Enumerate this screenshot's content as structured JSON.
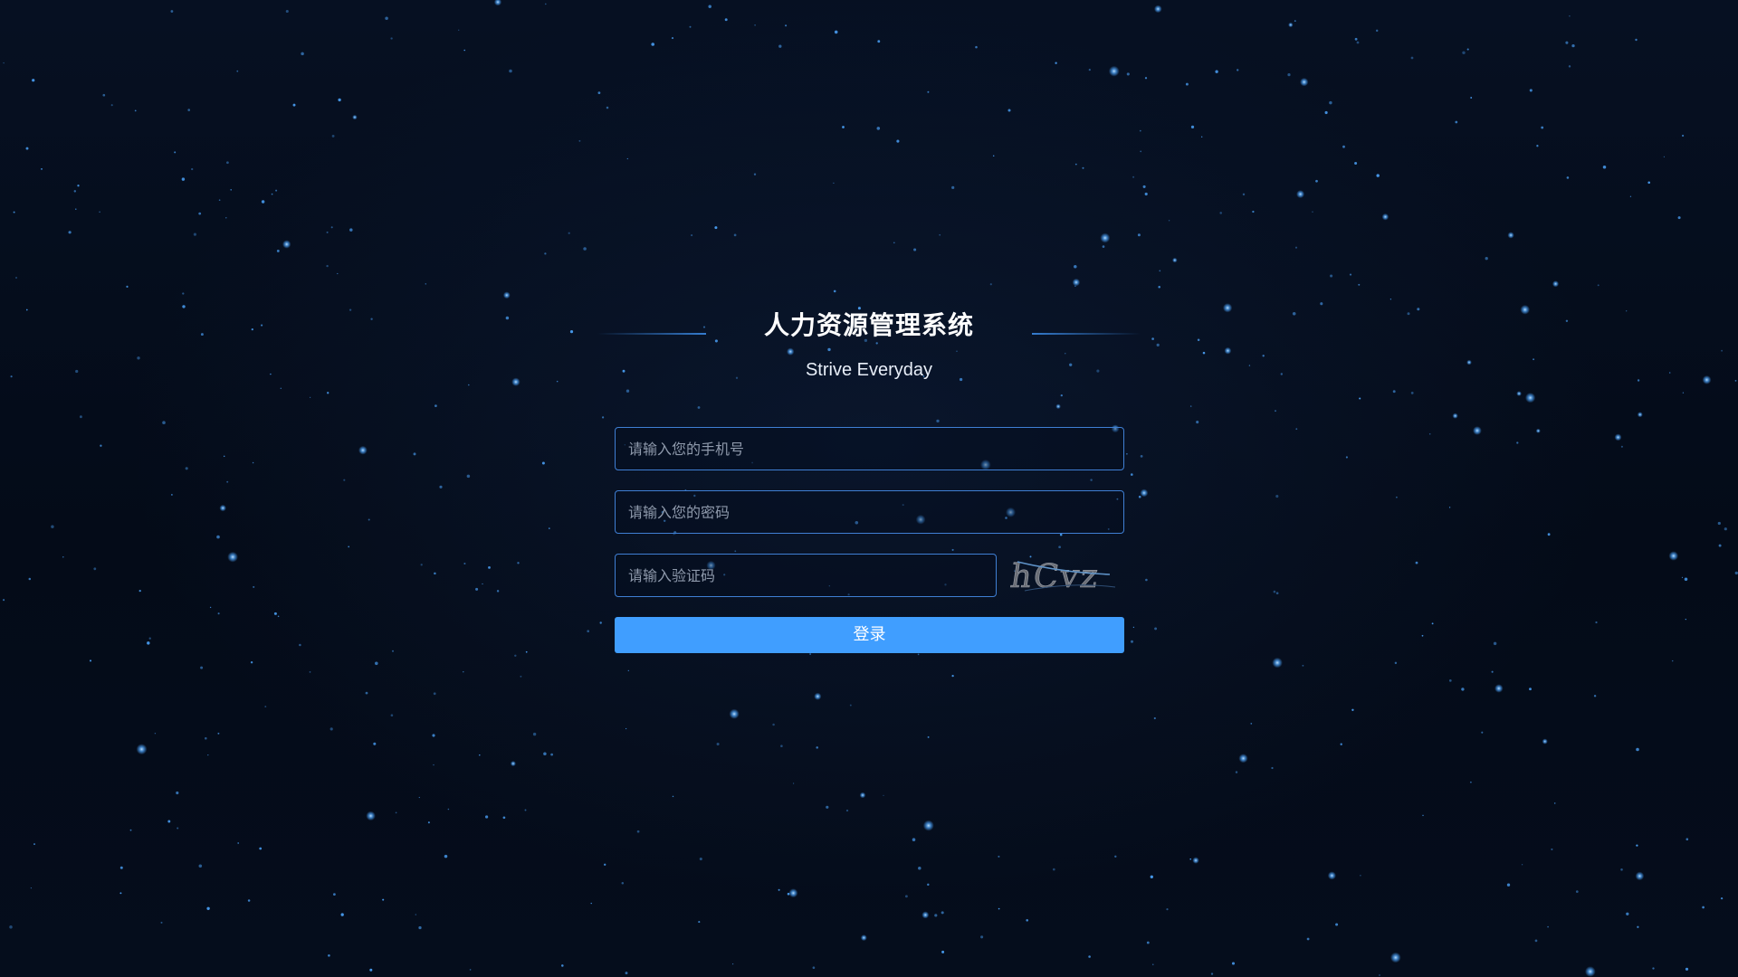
{
  "app": {
    "title": "人力资源管理系统",
    "subtitle": "Strive Everyday"
  },
  "form": {
    "phone_placeholder": "请输入您的手机号",
    "password_placeholder": "请输入您的密码",
    "captcha_placeholder": "请输入验证码",
    "captcha_text": "hCvz",
    "login_label": "登录"
  },
  "colors": {
    "background": "#050d1b",
    "star": "#4da6ff",
    "input_border": "#3f7fd4",
    "button": "#409eff",
    "text": "#ffffff"
  }
}
